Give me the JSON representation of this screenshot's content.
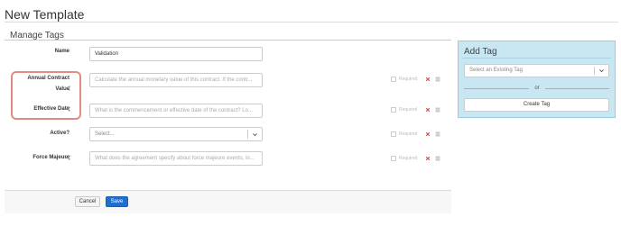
{
  "page": {
    "title": "New Template"
  },
  "manage_tags": {
    "title": "Manage Tags",
    "required_label": "Required",
    "fields": [
      {
        "label": "Name",
        "value": "Validation",
        "placeholder": ""
      },
      {
        "label_line1": "Annual Contract",
        "label_line2": "Value",
        "placeholder": "Calculate the annual monetary value of this contract. If the contr..."
      },
      {
        "label": "Effective Date",
        "placeholder": "What is the commencement or effective date of the contract? Lo..."
      },
      {
        "label": "Active?",
        "select_placeholder": "Select..."
      },
      {
        "label": "Force Majeure",
        "placeholder": "What does the agreement specify about force majeure events, in..."
      }
    ]
  },
  "footer": {
    "cancel_label": "Cancel",
    "save_label": "Save"
  },
  "add_tag": {
    "title": "Add Tag",
    "select_placeholder": "Select an Existing Tag",
    "or_text": "or",
    "create_label": "Create Tag"
  },
  "colors": {
    "highlight": "#e28b82",
    "save_button": "#1f6fd0",
    "add_tag_panel": "#c9e6f3",
    "delete_icon": "#d9534f"
  },
  "icons": [
    "share-icon",
    "delete-x-icon",
    "drag-handle-icon",
    "chevron-down-icon"
  ]
}
